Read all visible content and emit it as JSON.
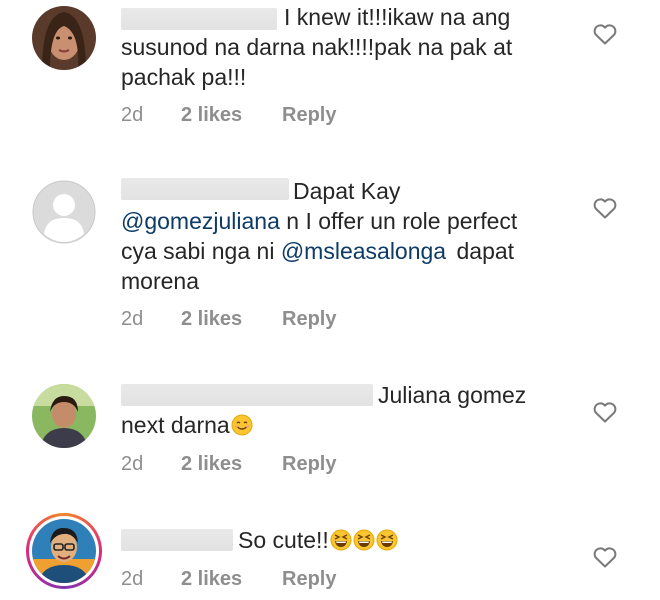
{
  "comments": [
    {
      "lines": [
        "I knew it!!!ikaw na ang",
        "susunod na darna nak!!!!pak na pak at",
        "pachak pa!!!"
      ],
      "time": "2d",
      "likes": "2 likes",
      "reply": "Reply",
      "avatar_icon": "profile-photo-woman",
      "heart_icon": "heart-outline-icon"
    },
    {
      "lines": [
        "Dapat Kay",
        "n I offer un role perfect",
        "cya sabi nga ni",
        "dapat",
        "morena"
      ],
      "mentions": [
        "@gomezjuliana",
        "@msleasalonga"
      ],
      "time": "2d",
      "likes": "2 likes",
      "reply": "Reply",
      "avatar_icon": "default-profile-icon",
      "heart_icon": "heart-outline-icon"
    },
    {
      "lines": [
        "Juliana gomez",
        "next darna"
      ],
      "emoji": "smiling-face-emoji",
      "time": "2d",
      "likes": "2 likes",
      "reply": "Reply",
      "avatar_icon": "profile-photo-woman-outdoors",
      "heart_icon": "heart-outline-icon"
    },
    {
      "lines": [
        "So cute!!"
      ],
      "emoji": "grinning-squinting-face-emoji",
      "time": "2d",
      "likes": "2 likes",
      "reply": "Reply",
      "avatar_icon": "profile-photo-man-story-ring",
      "heart_icon": "heart-outline-icon"
    }
  ],
  "colors": {
    "text": "#262626",
    "meta": "#8e8e8e",
    "mention": "#0d3b66",
    "story_ring_start": "#f58529",
    "story_ring_end": "#dd2a7b"
  }
}
